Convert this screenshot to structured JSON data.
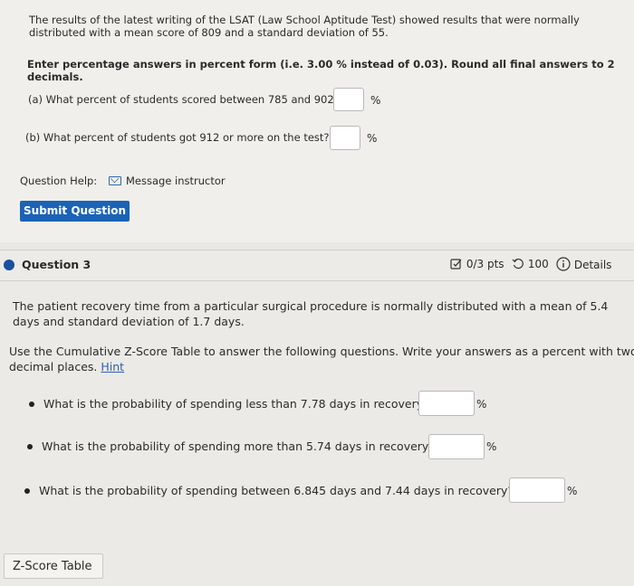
{
  "previous_question": {
    "intro_line1": "The results of the latest writing of the LSAT (Law School Aptitude Test) showed results that were normally",
    "intro_line2": "distributed with a mean score of 809 and a standard deviation of 55.",
    "instruction_line1": "Enter percentage answers in percent form (i.e. 3.00 % instead of 0.03). Round all final answers to 2",
    "instruction_line2": "decimals.",
    "part_a": "(a) What percent of students scored between 785 and 902?",
    "part_a_unit": "%",
    "part_b": "(b) What percent of students got 912 or more on the test?",
    "part_b_unit": "%",
    "help_label": "Question Help:",
    "message_link": "Message instructor",
    "submit_label": "Submit Question"
  },
  "question3": {
    "title": "Question 3",
    "score": "0/3 pts",
    "attempts": "100",
    "details_label": "Details",
    "stem_line1": "The patient recovery time from a particular surgical procedure is normally distributed with a mean of 5.4",
    "stem_line2": "days and standard deviation of 1.7 days.",
    "instr_line1": "Use the Cumulative Z-Score Table to answer the following questions. Write your answers as a percent with two",
    "instr_line2": "decimal places.",
    "hint_label": "Hint",
    "items": [
      {
        "text": "What is the probability of spending less than 7.78 days in recovery?",
        "unit": "%"
      },
      {
        "text": "What is the probability of spending more than 5.74 days in recovery?",
        "unit": "%"
      },
      {
        "text": "What is the probability of spending between 6.845 days and 7.44 days in recovery?",
        "unit": "%"
      }
    ],
    "ztable_button": "Z-Score Table"
  },
  "colors": {
    "primary_button": "#1b63b7",
    "link": "#2b5fb0",
    "status_dot": "#1a4fa0"
  }
}
